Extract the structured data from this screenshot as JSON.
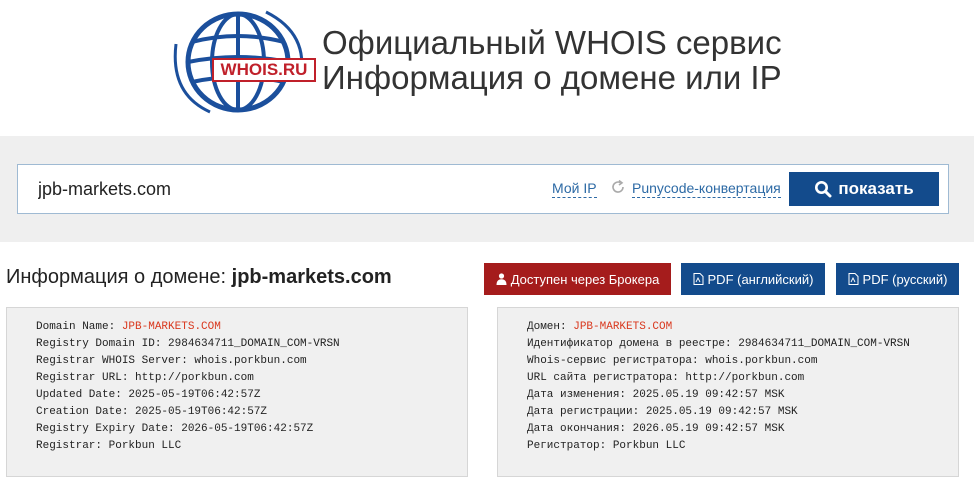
{
  "header": {
    "logo_text": "WHOIS.RU",
    "title": "Официальный WHOIS сервис",
    "subtitle": "Информация о домене или IP"
  },
  "search": {
    "value": "jpb-markets.com",
    "my_ip_label": "Мой IP",
    "punycode_label": "Punycode-конвертация",
    "show_label": "показать"
  },
  "info": {
    "heading_prefix": "Информация о домене: ",
    "domain": "jpb-markets.com",
    "broker_label": "Доступен через Брокера",
    "pdf_en_label": "PDF (английский)",
    "pdf_ru_label": "PDF (русский)"
  },
  "whois_en": {
    "l0_label": "Domain Name: ",
    "l0_value": "JPB-MARKETS.COM",
    "l1": "Registry Domain ID: 2984634711_DOMAIN_COM-VRSN",
    "l2": "Registrar WHOIS Server: whois.porkbun.com",
    "l3": "Registrar URL: http://porkbun.com",
    "l4": "Updated Date: 2025-05-19T06:42:57Z",
    "l5": "Creation Date: 2025-05-19T06:42:57Z",
    "l6": "Registry Expiry Date: 2026-05-19T06:42:57Z",
    "l7": "Registrar: Porkbun LLC"
  },
  "whois_ru": {
    "l0_label": "Домен: ",
    "l0_value": "JPB-MARKETS.COM",
    "l1": "Идентификатор домена в реестре: 2984634711_DOMAIN_COM-VRSN",
    "l2": "Whois-сервис регистратора: whois.porkbun.com",
    "l3": "URL сайта регистратора: http://porkbun.com",
    "l4": "Дата изменения: 2025.05.19 09:42:57 MSK",
    "l5": "Дата регистрации: 2025.05.19 09:42:57 MSK",
    "l6": "Дата окончания: 2026.05.19 09:42:57 MSK",
    "l7": "Регистратор: Porkbun LLC"
  },
  "colors": {
    "primary_blue": "#134b8c",
    "broker_red": "#a51c1c",
    "domain_highlight": "#d9381e",
    "search_band": "#efefef"
  },
  "icons": [
    "globe-logo-icon",
    "refresh-icon",
    "search-icon",
    "user-icon",
    "pdf-icon"
  ]
}
